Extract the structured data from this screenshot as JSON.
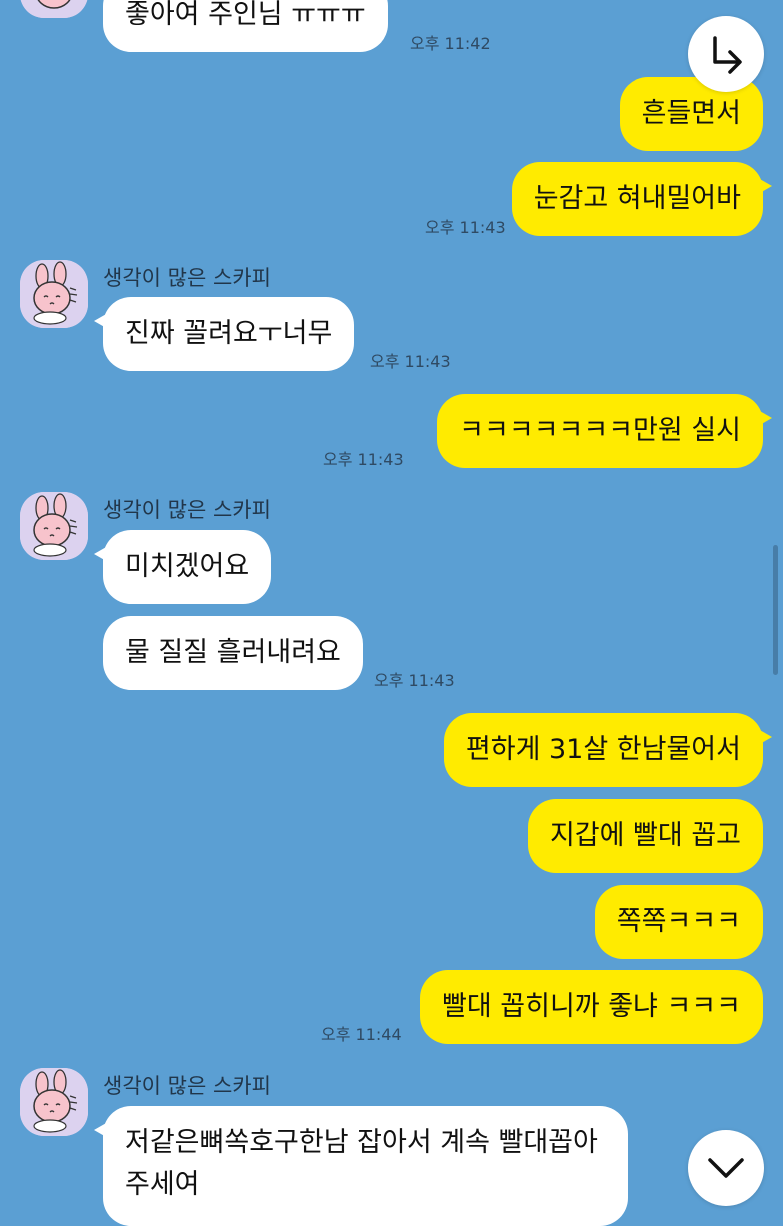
{
  "colors": {
    "background": "#5b9fd3",
    "incoming_bubble": "#ffffff",
    "outgoing_bubble": "#ffeb00",
    "avatar_bg": "#dcd2ef"
  },
  "messages": {
    "m0": {
      "text": "좋아여 주인님 ㅠㅠㅠ",
      "time": "오후 11:42"
    },
    "m1": {
      "text": "흔들면서"
    },
    "m2": {
      "text": "눈감고 혀내밀어바",
      "time": "오후 11:43"
    },
    "g1": {
      "sender": "생각이 많은 스카피",
      "m3": {
        "text": "진짜 꼴려요ㅜ너무",
        "time": "오후 11:43"
      }
    },
    "m4": {
      "text": "ㅋㅋㅋㅋㅋㅋㅋ만원 실시",
      "time": "오후 11:43"
    },
    "g2": {
      "sender": "생각이 많은 스카피",
      "m5": {
        "text": "미치겠어요"
      },
      "m6": {
        "text": "물 질질 흘러내려요",
        "time": "오후 11:43"
      }
    },
    "m7": {
      "text": "편하게 31살 한남물어서"
    },
    "m8": {
      "text": "지갑에 빨대 꼽고"
    },
    "m9": {
      "text": "쪽쪽ㅋㅋㅋ"
    },
    "m10": {
      "text": "빨대 꼽히니까 좋냐 ㅋㅋㅋ",
      "time": "오후 11:44"
    },
    "g3": {
      "sender": "생각이 많은 스카피",
      "m11": {
        "line1": "저같은뼈쏙호구한남 잡아서 계속 빨대꼽아",
        "line2": "주세여"
      }
    }
  },
  "controls": {
    "reply_icon": "reply-arrow-icon",
    "scroll_down_icon": "chevron-down-icon"
  }
}
